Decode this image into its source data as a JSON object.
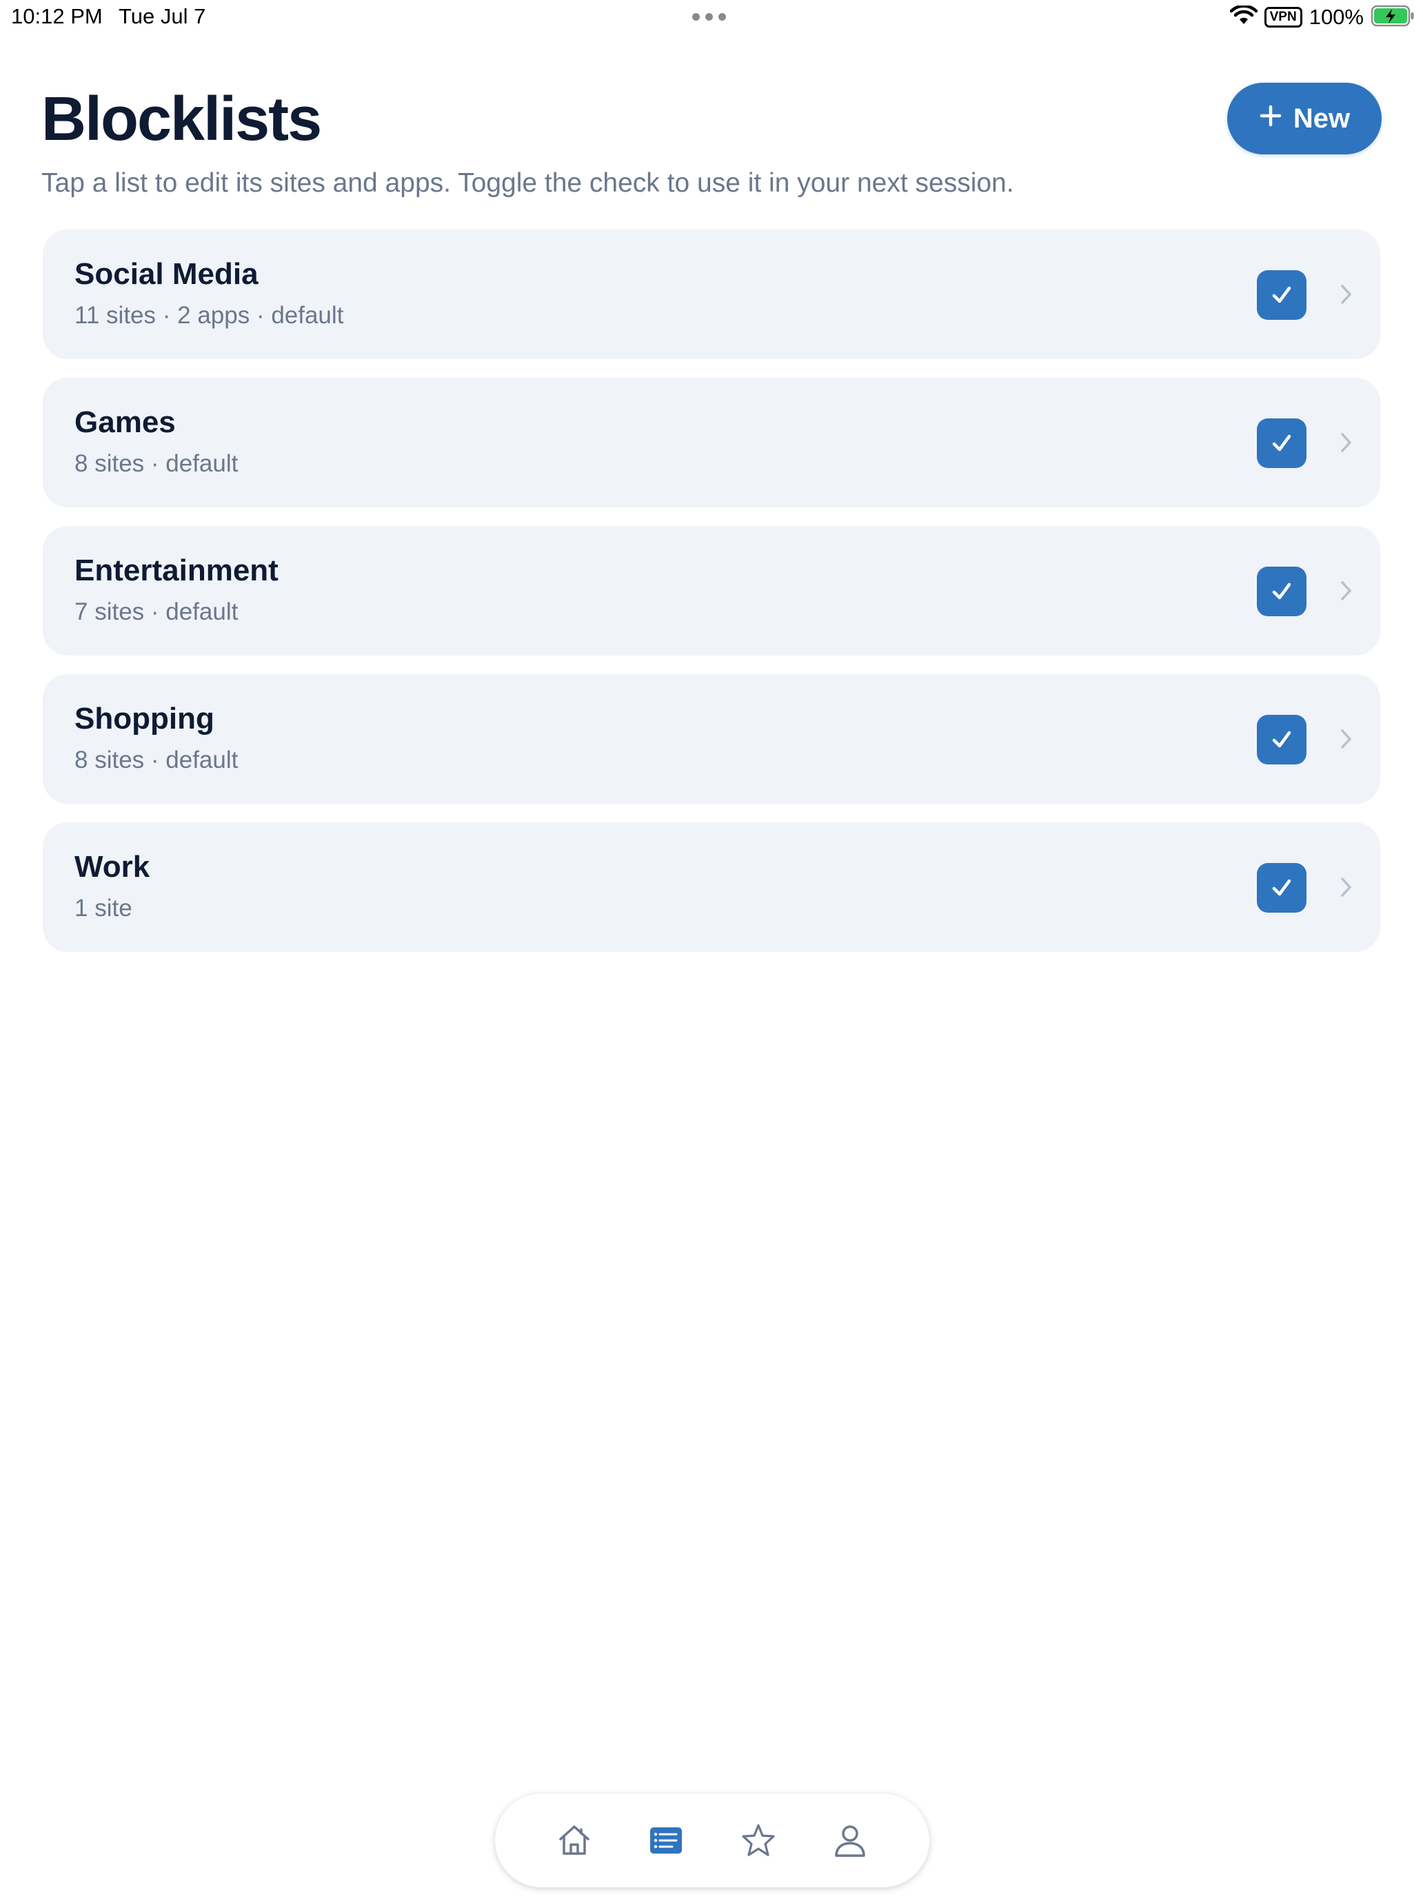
{
  "status_bar": {
    "time": "10:12 PM",
    "date": "Tue Jul 7",
    "vpn": "VPN",
    "battery": "100%"
  },
  "header": {
    "title": "Blocklists",
    "new_button_label": "New",
    "subtitle": "Tap a list to edit its sites and apps. Toggle the check to use it in your next session."
  },
  "lists": [
    {
      "title": "Social Media",
      "meta": "11 sites · 2 apps · default",
      "checked": true
    },
    {
      "title": "Games",
      "meta": "8 sites · default",
      "checked": true
    },
    {
      "title": "Entertainment",
      "meta": "7 sites · default",
      "checked": true
    },
    {
      "title": "Shopping",
      "meta": "8 sites · default",
      "checked": true
    },
    {
      "title": "Work",
      "meta": "1 site",
      "checked": true
    }
  ],
  "tab_bar": {
    "tabs": [
      "home-icon",
      "list-icon",
      "star-icon",
      "person-icon"
    ],
    "active_index": 1
  },
  "colors": {
    "accent": "#2f74bf",
    "card_bg": "#f0f3f8",
    "title": "#0f1b33",
    "secondary_text": "#6b778c",
    "battery_green": "#34c759"
  }
}
